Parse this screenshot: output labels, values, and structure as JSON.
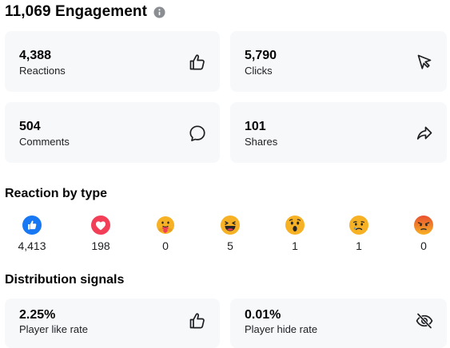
{
  "header": {
    "title": "11,069 Engagement",
    "info_icon": "info-icon"
  },
  "metrics": {
    "reactions": {
      "value": "4,388",
      "label": "Reactions",
      "icon": "thumbs-up-icon"
    },
    "clicks": {
      "value": "5,790",
      "label": "Clicks",
      "icon": "cursor-icon"
    },
    "comments": {
      "value": "504",
      "label": "Comments",
      "icon": "comment-icon"
    },
    "shares": {
      "value": "101",
      "label": "Shares",
      "icon": "share-icon"
    }
  },
  "reaction_by_type": {
    "title": "Reaction by type",
    "items": [
      {
        "type": "like",
        "count": "4,413",
        "icon": "like-reaction-icon",
        "color": "#1877f2"
      },
      {
        "type": "love",
        "count": "198",
        "icon": "love-reaction-icon",
        "color": "#f33e58"
      },
      {
        "type": "care",
        "count": "0",
        "icon": "care-reaction-icon",
        "color": "#f7b125"
      },
      {
        "type": "haha",
        "count": "5",
        "icon": "haha-reaction-icon",
        "color": "#f7b125"
      },
      {
        "type": "wow",
        "count": "1",
        "icon": "wow-reaction-icon",
        "color": "#f7b125"
      },
      {
        "type": "sad",
        "count": "1",
        "icon": "sad-reaction-icon",
        "color": "#f7b125"
      },
      {
        "type": "angry",
        "count": "0",
        "icon": "angry-reaction-icon",
        "color": "#e9710f"
      }
    ]
  },
  "distribution": {
    "title": "Distribution signals",
    "like_rate": {
      "value": "2.25%",
      "label": "Player like rate",
      "icon": "thumbs-up-icon"
    },
    "hide_rate": {
      "value": "0.01%",
      "label": "Player hide rate",
      "icon": "eye-off-icon"
    }
  }
}
